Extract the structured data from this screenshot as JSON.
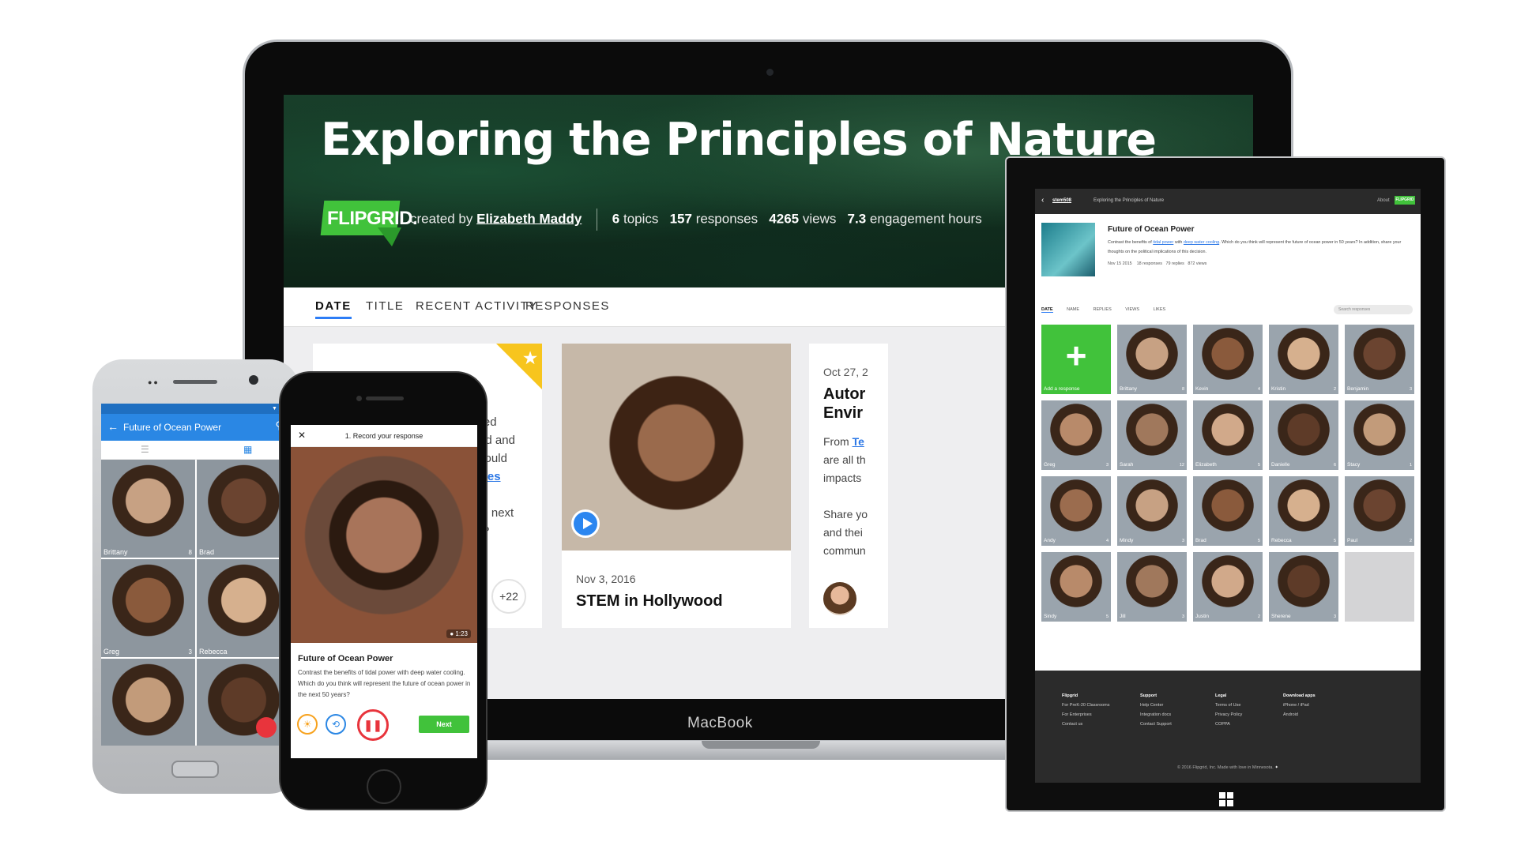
{
  "colors": {
    "brand_green": "#41c23b",
    "accent_blue": "#2b87e4",
    "star_yellow": "#f7c51e",
    "record_red": "#e8343c"
  },
  "macbook": {
    "brand": "MacBook",
    "hero": {
      "title": "Exploring the Principles of Nature",
      "logo": "FLIPGRID.",
      "created_by_label": "created by",
      "author": "Elizabeth Maddy",
      "stats": {
        "topics": "6",
        "topics_label": "topics",
        "responses": "157",
        "responses_label": "responses",
        "views": "4265",
        "views_label": "views",
        "hours": "7.3",
        "hours_label": "engagement hours"
      }
    },
    "tabs": [
      "DATE",
      "TITLE",
      "RECENT ACTIVITY",
      "RESPONSES"
    ],
    "card1": {
      "line1": "and catalogued",
      "line2": "pecies on land and",
      "line3": "d that there could",
      "link": "million species",
      "line4": "ll discover the next",
      "line5": "hink it will be?",
      "more": "+22"
    },
    "card2": {
      "date": "Nov 3, 2016",
      "title": "STEM in Hollywood"
    },
    "card3": {
      "date": "Oct 27, 2",
      "title_1": "Autor",
      "title_2": "Envir",
      "from": "From",
      "from_link": "Te",
      "p1": "are all th",
      "p2": "impacts",
      "p3": "Share yo",
      "p4": "and thei",
      "p5": "commun"
    }
  },
  "tablet": {
    "top": {
      "user": "stem508",
      "topic": "Exploring the Principles of Nature",
      "about": "About",
      "logo": "FLIPGRID"
    },
    "question": {
      "title": "Future of Ocean Power",
      "desc_1": "Contrast the benefits of",
      "link_1": "tidal power",
      "desc_2": "with",
      "link_2": "deep water cooling",
      "desc_3": ". Which do you think will represent the future of ocean power in 50 years? In addition, share your thoughts on the political implications of this decision.",
      "date": "Nov 15 2015",
      "responses": "18 responses",
      "replies": "79 replies",
      "views": "872 views"
    },
    "tabs": [
      "DATE",
      "NAME",
      "REPLIES",
      "VIEWS",
      "LIKES"
    ],
    "search_placeholder": "Search responses",
    "add_label": "Add a response",
    "responses": [
      {
        "name": "Brittany",
        "count": "8"
      },
      {
        "name": "Kevin",
        "count": "4"
      },
      {
        "name": "Kristin",
        "count": "2"
      },
      {
        "name": "Benjamin",
        "count": "3"
      },
      {
        "name": "Greg",
        "count": "3"
      },
      {
        "name": "Sarah",
        "count": "12"
      },
      {
        "name": "Elizabeth",
        "count": "5"
      },
      {
        "name": "Danielle",
        "count": "6"
      },
      {
        "name": "Stacy",
        "count": "1"
      },
      {
        "name": "Andy",
        "count": "4"
      },
      {
        "name": "Mindy",
        "count": "3"
      },
      {
        "name": "Brad",
        "count": "5"
      },
      {
        "name": "Rebecca",
        "count": "5"
      },
      {
        "name": "Paul",
        "count": "2"
      },
      {
        "name": "Sindy",
        "count": "5"
      },
      {
        "name": "Jill",
        "count": "3"
      },
      {
        "name": "Justin",
        "count": "2"
      },
      {
        "name": "Sherene",
        "count": "3"
      }
    ],
    "footer": {
      "col1": {
        "h": "Flipgrid",
        "items": [
          "For PreK-20 Classrooms",
          "For Enterprises",
          "Contact us"
        ]
      },
      "col2": {
        "h": "Support",
        "items": [
          "Help Center",
          "Integration docs",
          "Contact Support"
        ]
      },
      "col3": {
        "h": "Legal",
        "items": [
          "Terms of Use",
          "Privacy Policy",
          "COPPA"
        ]
      },
      "col4": {
        "h": "Download apps",
        "items": [
          "iPhone / iPad",
          "Android"
        ]
      },
      "copyright": "© 2016 Flipgrid, Inc. Made with love in Minnesota."
    }
  },
  "android": {
    "title": "Future of Ocean Power",
    "responses": [
      {
        "name": "Brittany",
        "count": "8"
      },
      {
        "name": "Brad",
        "count": ""
      },
      {
        "name": "Greg",
        "count": "3"
      },
      {
        "name": "Rebecca",
        "count": ""
      },
      {
        "name": "",
        "count": ""
      },
      {
        "name": "",
        "count": ""
      }
    ]
  },
  "iphone": {
    "step": "1. Record your response",
    "time": "1:23",
    "question": "Future of Ocean Power",
    "desc": "Contrast the benefits of tidal power with deep water cooling. Which do you think will represent the future of ocean power in the next 50 years?",
    "next": "Next"
  }
}
